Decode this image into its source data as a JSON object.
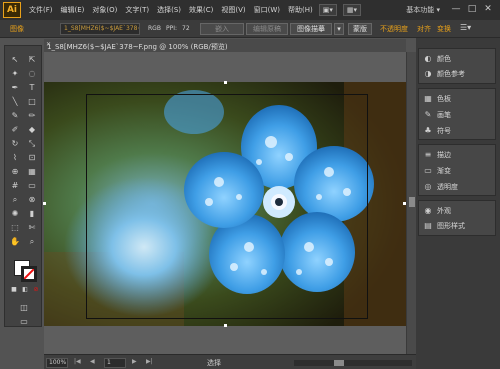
{
  "menubar": {
    "logo": "Ai",
    "items": [
      "文件(F)",
      "编辑(E)",
      "对象(O)",
      "文字(T)",
      "选择(S)",
      "效果(C)",
      "视图(V)",
      "窗口(W)",
      "帮助(H)"
    ],
    "workspace": "基本功能 ▾",
    "window_controls": [
      "—",
      "□",
      "✕"
    ]
  },
  "controlbar": {
    "image_label": "图像",
    "filename_field": "1_S8[MHZ6($~$JAE`378~F.png",
    "rgb": "RGB",
    "ppi_label": "PPI:",
    "ppi_value": "72",
    "embed_button": "嵌入",
    "edit_original_button": "编辑原稿",
    "image_trace_button": "图像描摹",
    "mask_button": "蒙版",
    "opacity_label": "不透明度",
    "align_label": "对齐",
    "transform_label": "变换"
  },
  "document": {
    "tab_title": "1_S8[MHZ6($~$JAE`378~F.png @ 100% (RGB/预览)",
    "close_glyph": "✕"
  },
  "statusbar": {
    "zoom": "100%",
    "page": "1",
    "status_text": "选择",
    "nav_first": "|◀",
    "nav_prev": "◀",
    "nav_next": "▶",
    "nav_last": "▶|"
  },
  "right_panels": {
    "group1": [
      {
        "icon": "color-icon",
        "label": "颜色"
      },
      {
        "icon": "color-guide-icon",
        "label": "颜色参考"
      }
    ],
    "group2": [
      {
        "icon": "swatches-icon",
        "label": "色板"
      },
      {
        "icon": "brushes-icon",
        "label": "画笔"
      },
      {
        "icon": "symbols-icon",
        "label": "符号"
      }
    ],
    "group3": [
      {
        "icon": "stroke-icon",
        "label": "描边"
      },
      {
        "icon": "gradient-icon",
        "label": "渐变"
      },
      {
        "icon": "transparency-icon",
        "label": "透明度"
      }
    ],
    "group4": [
      {
        "icon": "appearance-icon",
        "label": "外观"
      },
      {
        "icon": "graphic-styles-icon",
        "label": "图形样式"
      }
    ]
  },
  "colors": {
    "accent": "#e8a11a",
    "flower": "#4aa8e8",
    "background_panel": "#535353"
  }
}
